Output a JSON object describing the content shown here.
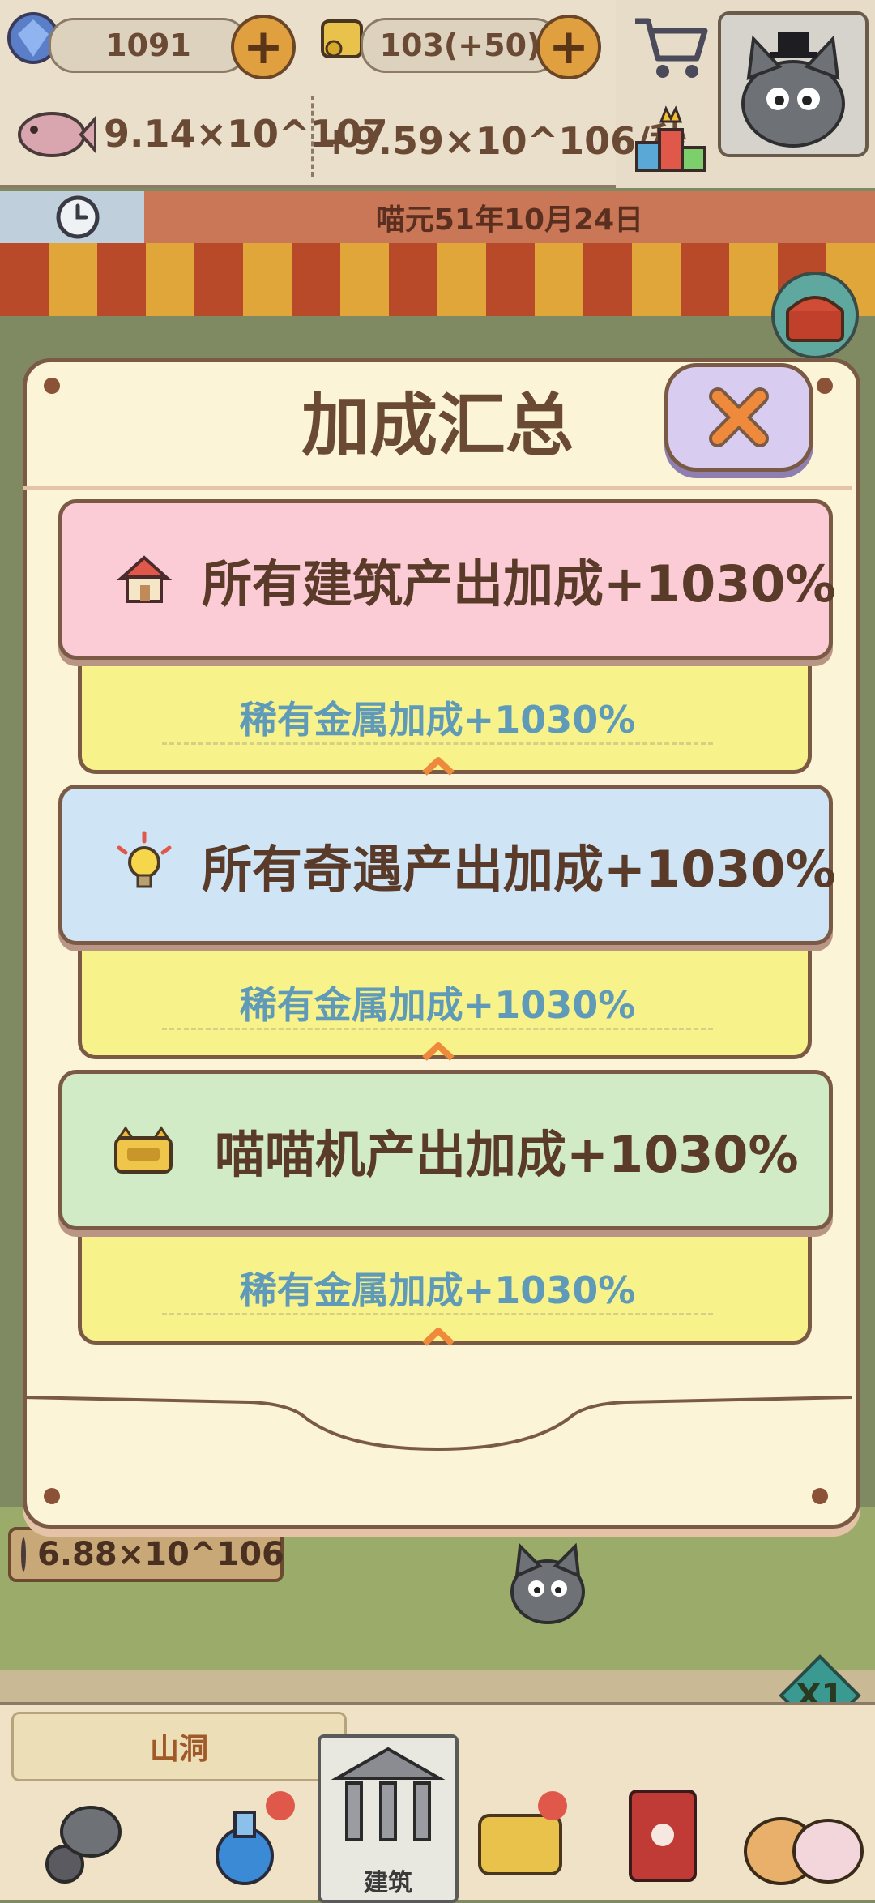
{
  "hud": {
    "gems": "1091",
    "tickets": "103(+50)",
    "fish_total": "9.14×10^107",
    "fish_rate": "+9.59×10^106/秒",
    "date": "喵元51年10月24日"
  },
  "scene": {
    "floor_income": "6.88×10^106",
    "area_label": "山洞",
    "speed": "X1",
    "nav_building": "建筑"
  },
  "modal": {
    "title": "加成汇总",
    "cards": [
      {
        "label": "所有建筑产出加成+1030%",
        "sub": "稀有金属加成+1030%",
        "color": "#fcccd6",
        "icon": "house-icon"
      },
      {
        "label": "所有奇遇产出加成+1030%",
        "sub": "稀有金属加成+1030%",
        "color": "#cfe5f5",
        "icon": "lightbulb-icon"
      },
      {
        "label": "喵喵机产出加成+1030%",
        "sub": "稀有金属加成+1030%",
        "color": "#d0ebc6",
        "icon": "meow-machine-icon"
      }
    ]
  },
  "colors": {
    "modal_bg": "#fbf4d6",
    "sub_bg": "#f8f28a",
    "close_bg": "#d8cdf0",
    "close_x": "#ef8a3c",
    "border": "#7a5a45"
  }
}
